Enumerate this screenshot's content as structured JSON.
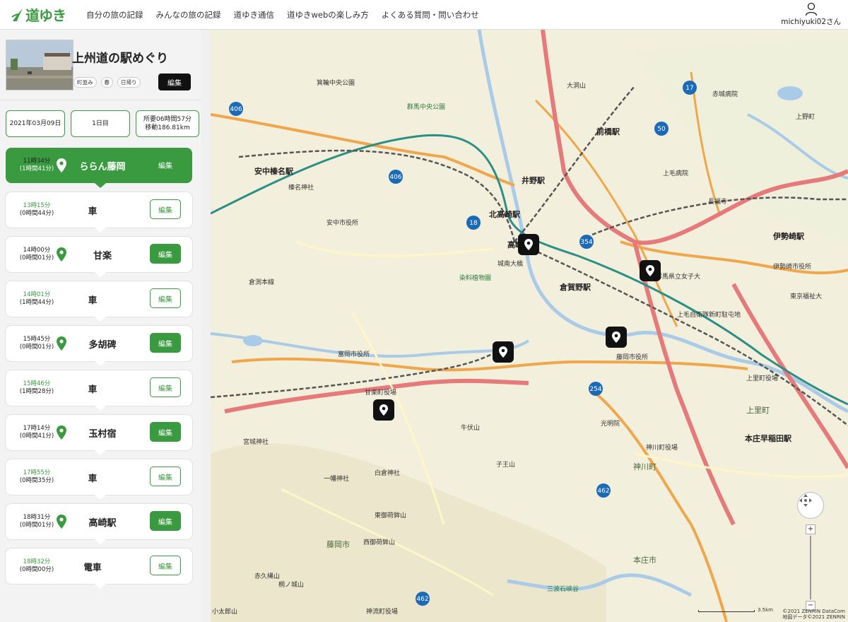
{
  "header": {
    "logo_text": "道ゆき",
    "nav": [
      "自分の旅の記録",
      "みんなの旅の記録",
      "道ゆき通信",
      "道ゆきwebの楽しみ方",
      "よくある質問・問い合わせ"
    ],
    "user": "michiyuki02さん"
  },
  "route": {
    "title": "上州道の駅めぐり",
    "tags": [
      "町並み",
      "春",
      "日帰り"
    ],
    "edit_label": "編集",
    "date": "2021年03月09日",
    "day": "1日目",
    "duration": "所要06時間57分",
    "distance": "移動186.81km"
  },
  "steps": [
    {
      "type": "spot",
      "active": true,
      "time": "11時34分",
      "stay": "(1時間41分)",
      "name": "ららん藤岡",
      "btn": "編集"
    },
    {
      "type": "move",
      "time": "13時15分",
      "stay": "(0時間44分)",
      "name": "車",
      "btn": "編集"
    },
    {
      "type": "spot",
      "time": "14時00分",
      "stay": "(0時間01分)",
      "name": "甘楽",
      "btn": "編集"
    },
    {
      "type": "move",
      "time": "14時01分",
      "stay": "(1時間44分)",
      "name": "車",
      "btn": "編集"
    },
    {
      "type": "spot",
      "time": "15時45分",
      "stay": "(0時間01分)",
      "name": "多胡碑",
      "btn": "編集"
    },
    {
      "type": "move",
      "time": "15時46分",
      "stay": "(1時間28分)",
      "name": "車",
      "btn": "編集"
    },
    {
      "type": "spot",
      "time": "17時14分",
      "stay": "(0時間41分)",
      "name": "玉村宿",
      "btn": "編集"
    },
    {
      "type": "move",
      "time": "17時55分",
      "stay": "(0時間35分)",
      "name": "車",
      "btn": "編集"
    },
    {
      "type": "spot",
      "time": "18時31分",
      "stay": "(0時間01分)",
      "name": "高崎駅",
      "btn": "編集"
    },
    {
      "type": "move",
      "time": "18時32分",
      "stay": "(0時間00分)",
      "name": "電車",
      "btn": "編集"
    }
  ],
  "map": {
    "labels": {
      "l1": "前橋駅",
      "l2": "井野駅",
      "l3": "北高崎駅",
      "l4": "倉賀野駅",
      "l5": "伊勢崎駅",
      "l6": "安中榛名駅",
      "l7": "安中市役所",
      "l8": "富岡市役所",
      "l9": "甘楽町役場",
      "l10": "藤岡市役所",
      "l11": "上里町",
      "l12": "本庄早稲田駅",
      "l13": "神川町",
      "l14": "藤岡市",
      "l15": "本庄市",
      "l16": "赤城病院",
      "l17": "上毛病院",
      "l18": "伊勢崎市役所",
      "l19": "群馬県立女子大",
      "l20": "榛名神社",
      "l21": "白倉神社",
      "l22": "光明院",
      "l23": "神川町役場",
      "l24": "上里町役場",
      "l25": "染料植物園",
      "l26": "城南大橋",
      "l27": "倉渕本線",
      "l28": "上毛自衛隊新町駐屯地",
      "l29": "宮城神社",
      "l30": "一幡神社",
      "l31": "西御荷鉾山",
      "l32": "東御荷鉾山",
      "l33": "赤久縄山",
      "l34": "子王山",
      "l35": "牛伏山",
      "l36": "大洞山",
      "l37": "東京福祉大",
      "l38": "群馬中央公園",
      "l39": "箕輪中央公園",
      "l40": "長福寺",
      "l41": "上野町",
      "l42": "三波石峡谷",
      "l43": "神流町役場",
      "l44": "小太郎山",
      "l45": "桐ノ城山",
      "l46": "高崎駅"
    },
    "routes": [
      "406",
      "406",
      "18",
      "354",
      "254",
      "462",
      "17",
      "50",
      "462"
    ],
    "credit1": "©2021 ZENRIN DataCom",
    "credit2": "地図データ©2021 ZENRIN",
    "scale": "3.5km",
    "zoom_in": "+",
    "zoom_out": "−"
  },
  "colors": {
    "accent": "#3a9a3f",
    "marker": "#111111"
  }
}
